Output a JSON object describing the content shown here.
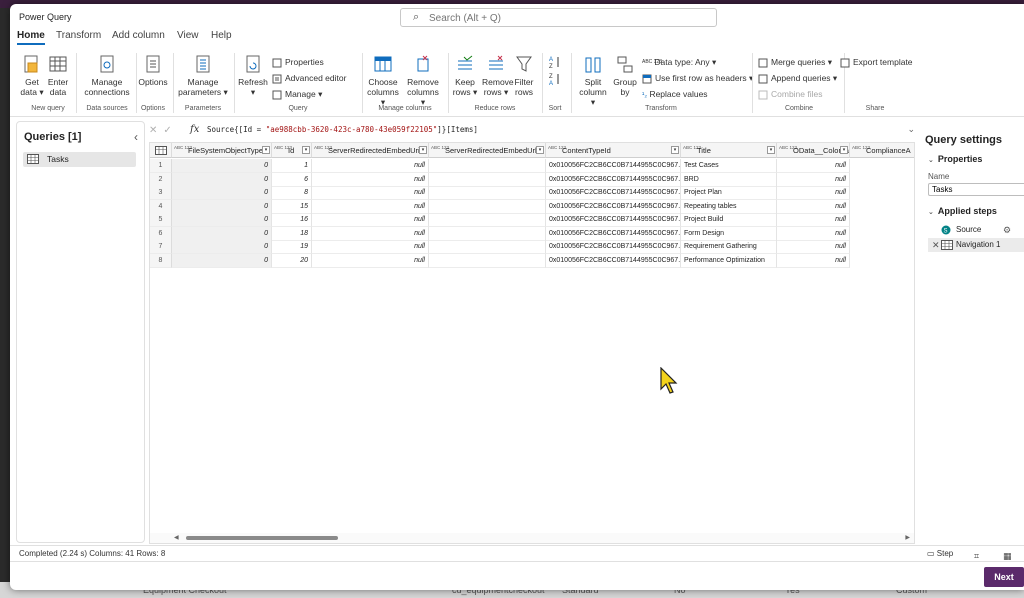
{
  "app": {
    "title": "Power Query"
  },
  "search": {
    "placeholder": "Search (Alt + Q)"
  },
  "menu": {
    "tabs": [
      "Home",
      "Transform",
      "Add column",
      "View",
      "Help"
    ],
    "active": "Home"
  },
  "ribbon": {
    "get_data": "Get data",
    "enter_data": "Enter data",
    "manage_connections": "Manage connections",
    "options": "Options",
    "manage_parameters": "Manage parameters",
    "refresh": "Refresh",
    "properties": "Properties",
    "advanced_editor": "Advanced editor",
    "manage": "Manage",
    "choose_columns": "Choose columns",
    "remove_columns": "Remove columns",
    "keep_rows": "Keep rows",
    "remove_rows": "Remove rows",
    "filter_rows": "Filter rows",
    "split_column": "Split column",
    "group_by": "Group by",
    "data_type": "Data type: Any",
    "use_first_row": "Use first row as headers",
    "replace_values": "Replace values",
    "merge_queries": "Merge queries",
    "append_queries": "Append queries",
    "combine_files": "Combine files",
    "export_template": "Export template",
    "groups": {
      "new_query": "New query",
      "data_sources": "Data sources",
      "options": "Options",
      "parameters": "Parameters",
      "query": "Query",
      "manage_columns": "Manage columns",
      "reduce_rows": "Reduce rows",
      "sort": "Sort",
      "transform": "Transform",
      "combine": "Combine",
      "share": "Share"
    }
  },
  "queries": {
    "title": "Queries [1]",
    "items": [
      "Tasks"
    ]
  },
  "formula": {
    "prefix": "Source{[Id = ",
    "id": "\"ae988cbb-3620-423c-a780-43e059f22105\"",
    "suffix": "]}[Items]"
  },
  "grid": {
    "columns": [
      {
        "name": "FileSystemObjectType",
        "type": "ABC 123"
      },
      {
        "name": "Id",
        "type": "ABC 123"
      },
      {
        "name": "ServerRedirectedEmbedUri",
        "type": "ABC 123"
      },
      {
        "name": "ServerRedirectedEmbedUrl",
        "type": "ABC 123"
      },
      {
        "name": "ContentTypeId",
        "type": "ABC 123"
      },
      {
        "name": "Title",
        "type": "ABC 123"
      },
      {
        "name": "OData__ColorTag",
        "type": "ABC 123"
      },
      {
        "name": "ComplianceA",
        "type": "ABC 123"
      }
    ],
    "rows": [
      [
        "1",
        "0",
        "1",
        "null",
        "",
        "0x010056FC2CB6CC0B7144955C0C967...",
        "Test Cases",
        "null"
      ],
      [
        "2",
        "0",
        "6",
        "null",
        "",
        "0x010056FC2CB6CC0B7144955C0C967...",
        "BRD",
        "null"
      ],
      [
        "3",
        "0",
        "8",
        "null",
        "",
        "0x010056FC2CB6CC0B7144955C0C967...",
        "Project Plan",
        "null"
      ],
      [
        "4",
        "0",
        "15",
        "null",
        "",
        "0x010056FC2CB6CC0B7144955C0C967...",
        "Repeating tables",
        "null"
      ],
      [
        "5",
        "0",
        "16",
        "null",
        "",
        "0x010056FC2CB6CC0B7144955C0C967...",
        "Project Build",
        "null"
      ],
      [
        "6",
        "0",
        "18",
        "null",
        "",
        "0x010056FC2CB6CC0B7144955C0C967...",
        "Form Design",
        "null"
      ],
      [
        "7",
        "0",
        "19",
        "null",
        "",
        "0x010056FC2CB6CC0B7144955C0C967...",
        "Requirement Gathering",
        "null"
      ],
      [
        "8",
        "0",
        "20",
        "null",
        "",
        "0x010056FC2CB6CC0B7144955C0C967...",
        "Performance Optimization",
        "null"
      ]
    ]
  },
  "settings": {
    "title": "Query settings",
    "properties": "Properties",
    "name_label": "Name",
    "name_value": "Tasks",
    "applied_steps": "Applied steps",
    "steps": [
      "Source",
      "Navigation 1"
    ]
  },
  "status": {
    "text": "Completed (2.24 s)   Columns: 41   Rows: 8",
    "step": "Step"
  },
  "footer": {
    "next": "Next"
  },
  "background": {
    "left": "Equipment Checkout",
    "mid": "cd_equipmentcheckout",
    "c3": "Standard",
    "c4": "No",
    "c5": "Yes",
    "c6": "Custom"
  },
  "colors": {
    "accent": "#0f6cbd",
    "next_button": "#5b2a6b",
    "cursor": "#f2d21b"
  }
}
